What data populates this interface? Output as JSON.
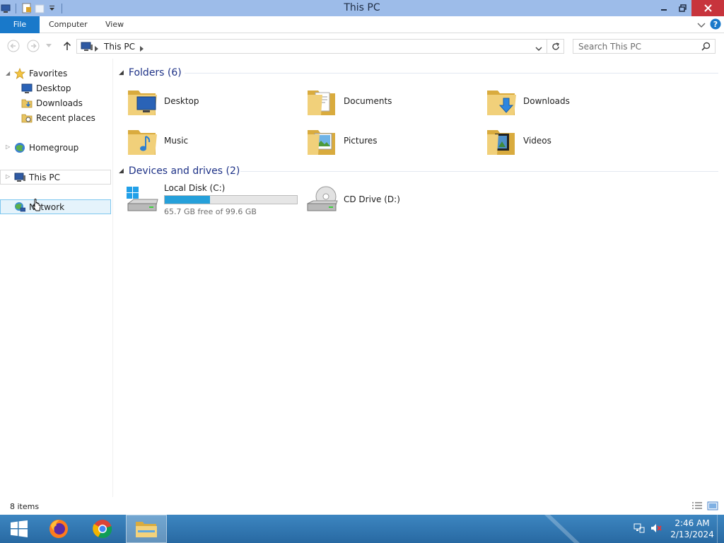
{
  "window": {
    "title": "This PC"
  },
  "ribbon": {
    "tabs": [
      "File",
      "Computer",
      "View"
    ]
  },
  "address": {
    "location": "This PC",
    "search_placeholder": "Search This PC"
  },
  "nav": {
    "favorites": {
      "label": "Favorites",
      "items": [
        "Desktop",
        "Downloads",
        "Recent places"
      ]
    },
    "homegroup": "Homegroup",
    "this_pc": "This PC",
    "network": "Network"
  },
  "content": {
    "folders_heading": "Folders (6)",
    "folders": [
      "Desktop",
      "Documents",
      "Downloads",
      "Music",
      "Pictures",
      "Videos"
    ],
    "drives_heading": "Devices and drives (2)",
    "drives": [
      {
        "name": "Local Disk (C:)",
        "free_text": "65.7 GB free of 99.6 GB",
        "used_fraction": 0.34
      },
      {
        "name": "CD Drive (D:)"
      }
    ]
  },
  "status": {
    "item_count": "8 items"
  },
  "taskbar": {
    "time": "2:46 AM",
    "date": "2/13/2024"
  },
  "colors": {
    "accent": "#1979ca",
    "titlebar": "#9dbce9",
    "taskbar": "#2b6fa8",
    "drive_bar": "#26a0da"
  }
}
